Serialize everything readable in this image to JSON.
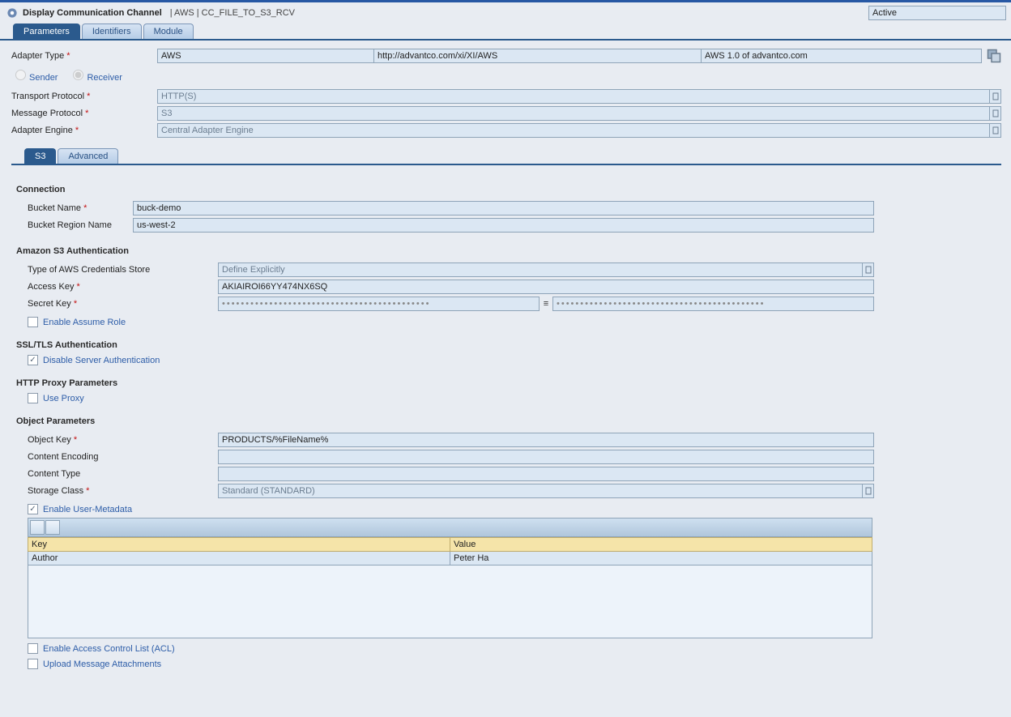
{
  "header": {
    "title": "Display Communication Channel",
    "path": "| AWS | CC_FILE_TO_S3_RCV",
    "status": "Active"
  },
  "tabs": {
    "t0": "Parameters",
    "t1": "Identifiers",
    "t2": "Module"
  },
  "adapter": {
    "label": "Adapter Type",
    "v1": "AWS",
    "v2": "http://advantco.com/xi/XI/AWS",
    "v3": "AWS 1.0 of advantco.com"
  },
  "direction": {
    "sender": "Sender",
    "receiver": "Receiver"
  },
  "transport": {
    "label": "Transport Protocol",
    "value": "HTTP(S)"
  },
  "message": {
    "label": "Message Protocol",
    "value": "S3"
  },
  "engine": {
    "label": "Adapter Engine",
    "value": "Central Adapter Engine"
  },
  "subtabs": {
    "s0": "S3",
    "s1": "Advanced"
  },
  "connection": {
    "title": "Connection",
    "bucket_label": "Bucket Name",
    "bucket": "buck-demo",
    "region_label": "Bucket Region Name",
    "region": "us-west-2"
  },
  "auth": {
    "title": "Amazon S3 Authentication",
    "store_label": "Type of AWS Credentials Store",
    "store": "Define Explicitly",
    "ak_label": "Access Key",
    "ak": "AKIAIROI66YY474NX6SQ",
    "sk_label": "Secret Key",
    "sk_a": "••••••••••••••••••••••••••••••••••••••••••••",
    "sk_b": "••••••••••••••••••••••••••••••••••••••••••••",
    "assume": "Enable Assume Role"
  },
  "ssl": {
    "title": "SSL/TLS Authentication",
    "disable": "Disable Server Authentication"
  },
  "proxy": {
    "title": "HTTP Proxy Parameters",
    "use": "Use Proxy"
  },
  "obj": {
    "title": "Object Parameters",
    "key_label": "Object Key",
    "key": "PRODUCTS/%FileName%",
    "enc_label": "Content Encoding",
    "enc": "",
    "ctype_label": "Content Type",
    "ctype": "",
    "storage_label": "Storage Class",
    "storage": "Standard (STANDARD)",
    "meta_enable": "Enable User-Metadata",
    "col_key": "Key",
    "col_value": "Value",
    "row_key": "Author",
    "row_value": "Peter Ha",
    "acl": "Enable Access Control List (ACL)",
    "attach": "Upload Message Attachments"
  }
}
